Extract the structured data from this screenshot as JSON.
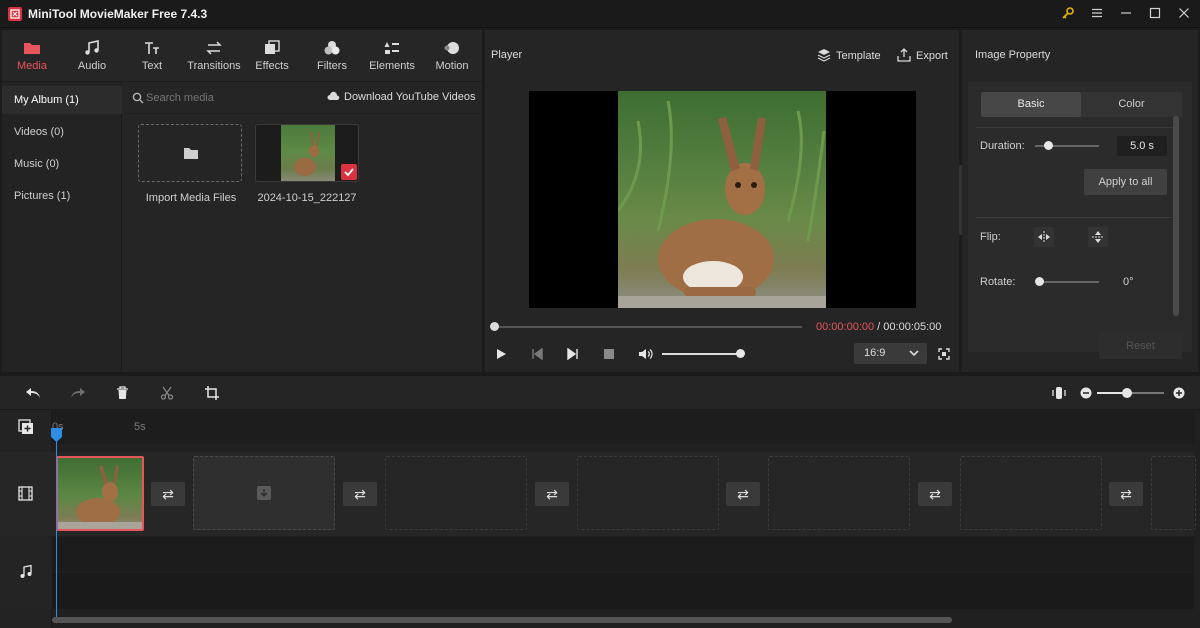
{
  "titlebar": {
    "title": "MiniTool MovieMaker Free 7.4.3"
  },
  "tabs": [
    {
      "label": "Media",
      "icon": "folder-icon"
    },
    {
      "label": "Audio",
      "icon": "music-note-icon"
    },
    {
      "label": "Text",
      "icon": "text-icon"
    },
    {
      "label": "Transitions",
      "icon": "transition-icon"
    },
    {
      "label": "Effects",
      "icon": "effects-icon"
    },
    {
      "label": "Filters",
      "icon": "filters-icon"
    },
    {
      "label": "Elements",
      "icon": "elements-icon"
    },
    {
      "label": "Motion",
      "icon": "motion-icon"
    }
  ],
  "sidebar": {
    "items": [
      {
        "label": "My Album (1)"
      },
      {
        "label": "Videos (0)"
      },
      {
        "label": "Music (0)"
      },
      {
        "label": "Pictures (1)"
      }
    ]
  },
  "search": {
    "placeholder": "Search media",
    "download_label": "Download YouTube Videos"
  },
  "media": {
    "import_label": "Import Media Files",
    "file_name": "2024-10-15_222127"
  },
  "player": {
    "title": "Player",
    "template_label": "Template",
    "export_label": "Export",
    "current_time": "00:00:00:00",
    "separator": " / ",
    "total_time": "00:00:05:00",
    "aspect_ratio": "16:9",
    "progress": 0,
    "volume": 1.0
  },
  "properties": {
    "title": "Image Property",
    "tab_basic": "Basic",
    "tab_color": "Color",
    "duration_label": "Duration:",
    "duration_value": "5.0 s",
    "apply_label": "Apply to all",
    "flip_label": "Flip:",
    "rotate_label": "Rotate:",
    "rotate_value": "0°",
    "reset_label": "Reset"
  },
  "timeline": {
    "ruler": [
      "0s",
      "5s"
    ]
  },
  "colors": {
    "accent": "#e8545c",
    "playhead": "#2f8de4",
    "time_red": "#e8545c"
  }
}
